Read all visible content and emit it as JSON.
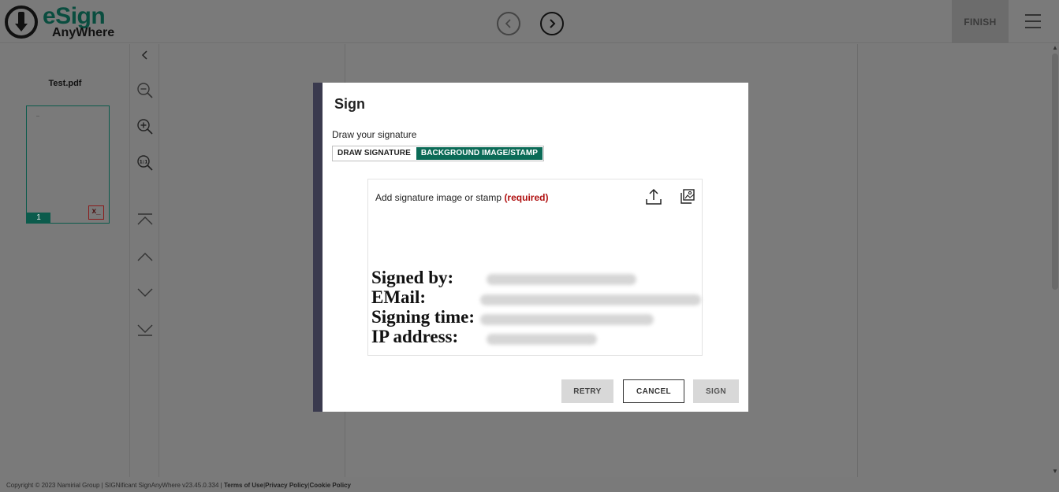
{
  "header": {
    "logo_title": "eSign",
    "logo_subtitle": "AnyWhere",
    "prev_icon": "chevron-left-circle-icon",
    "next_icon": "chevron-right-circle-icon",
    "finish_label": "FINISH",
    "menu_icon": "hamburger-menu-icon"
  },
  "thumbnails": {
    "document_name": "Test.pdf",
    "page_number": "1",
    "signature_field_icon": "signature-field-icon"
  },
  "tools": [
    {
      "name": "collapse-panel-icon"
    },
    {
      "name": "zoom-out-icon"
    },
    {
      "name": "zoom-in-icon"
    },
    {
      "name": "zoom-actual-size-icon"
    },
    {
      "name": "first-page-icon"
    },
    {
      "name": "previous-page-icon"
    },
    {
      "name": "next-page-icon"
    },
    {
      "name": "last-page-icon"
    }
  ],
  "dialog": {
    "title": "Sign",
    "subtitle": "Draw your signature",
    "tabs": [
      {
        "label": "DRAW SIGNATURE",
        "active": false
      },
      {
        "label": "BACKGROUND IMAGE/STAMP",
        "active": true
      }
    ],
    "stamp_prompt": "Add signature image or stamp",
    "stamp_required": "(required)",
    "stamp_lines": [
      {
        "label": "Signed by:"
      },
      {
        "label": "EMail:"
      },
      {
        "label": "Signing time:"
      },
      {
        "label": "IP address:"
      }
    ],
    "buttons": {
      "retry": "RETRY",
      "cancel": "CANCEL",
      "sign": "SIGN"
    }
  },
  "footer": {
    "copyright": "Copyright © 2023 Namirial Group | SIGNificant SignAnyWhere v23.45.0.334 |",
    "terms": "Terms of Use",
    "privacy": "Privacy Policy",
    "cookie": "Cookie Policy",
    "separator": "|"
  },
  "colors": {
    "brand_green": "#0b6b57",
    "required_red": "#b01010",
    "overlay_gray": "#7a7a7a",
    "dialog_accent": "#3a3a4e"
  }
}
